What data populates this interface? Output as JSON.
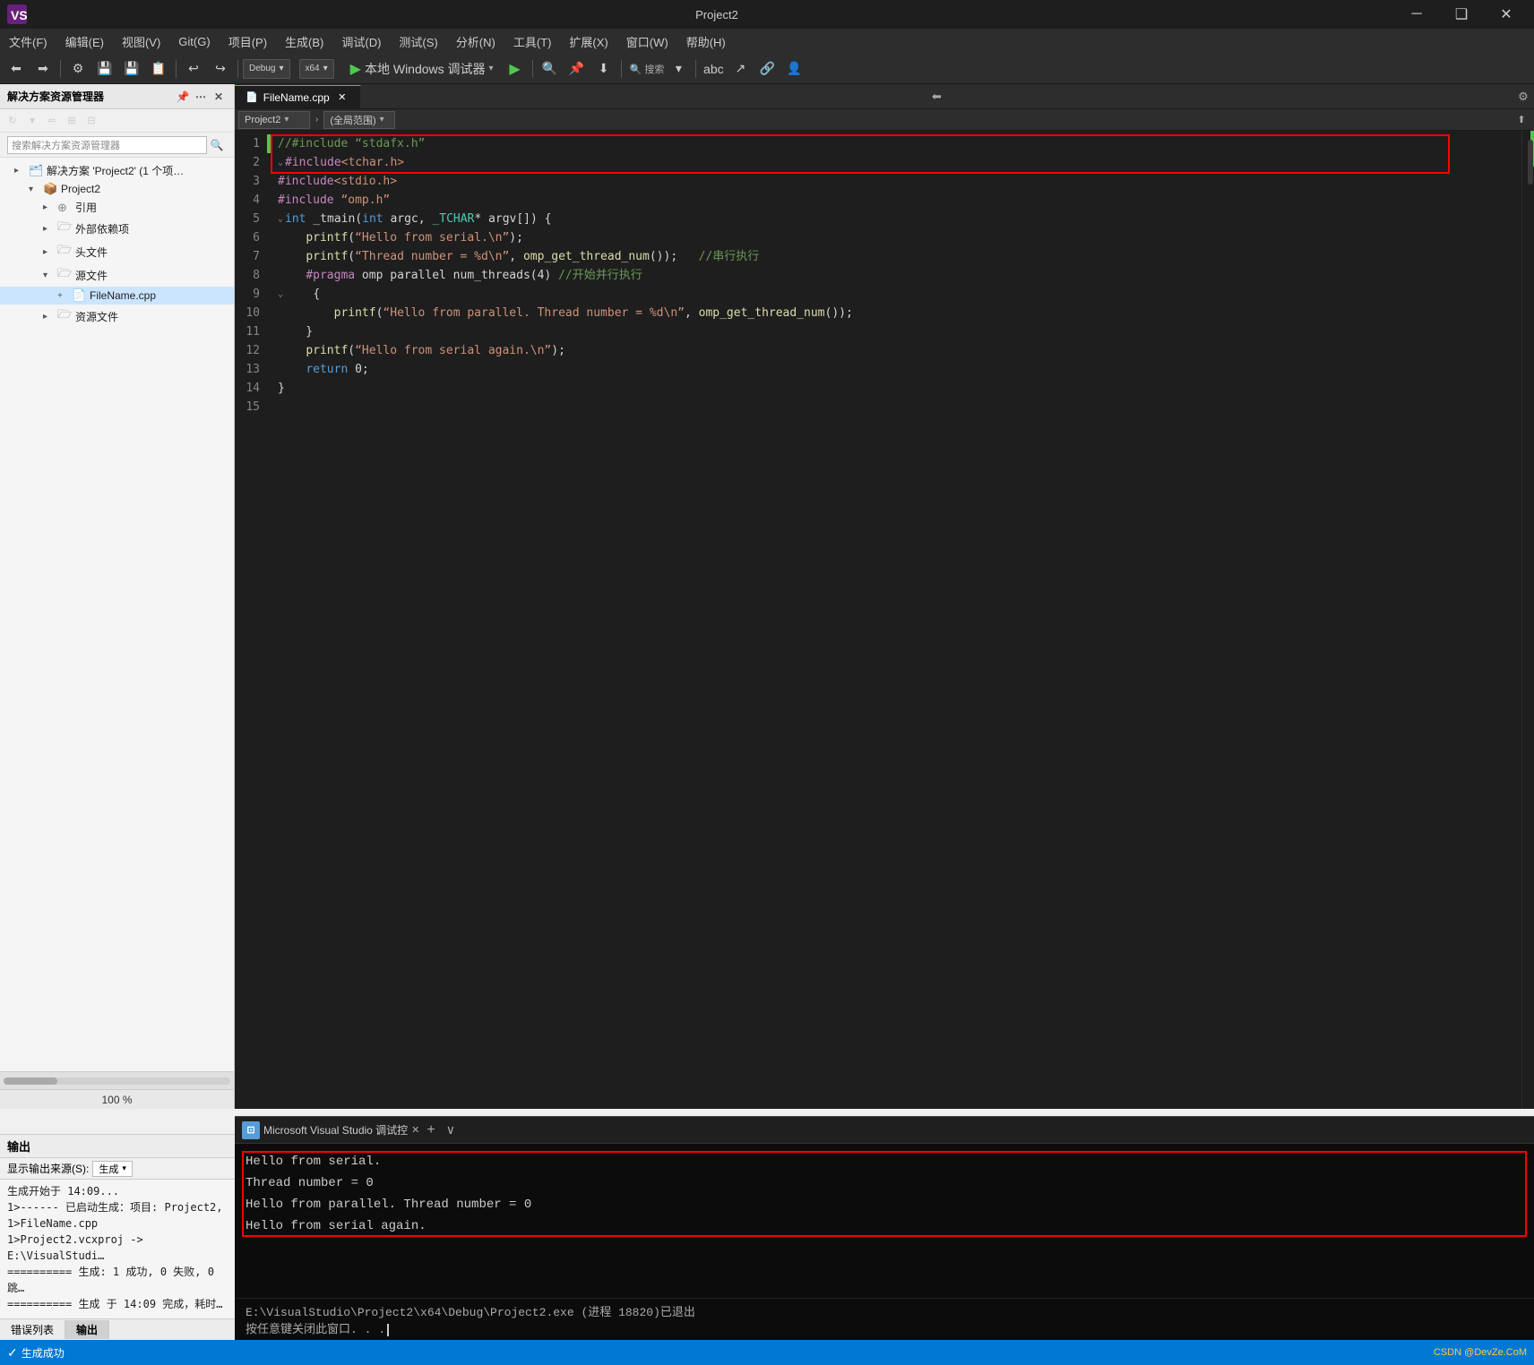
{
  "titleBar": {
    "title": "Project2",
    "minimizeLabel": "─",
    "restoreLabel": "❑",
    "closeLabel": "✕"
  },
  "menuBar": {
    "items": [
      "文件(F)",
      "编辑(E)",
      "视图(V)",
      "Git(G)",
      "项目(P)",
      "生成(B)",
      "调试(D)",
      "测试(S)",
      "分析(N)",
      "工具(T)",
      "扩展(X)",
      "窗口(W)",
      "帮助(H)"
    ]
  },
  "toolbar": {
    "debugConfig": "Debug",
    "platform": "x64",
    "runLabel": "▶ 本地 Windows 调试器",
    "zoomLabel": "100 %"
  },
  "sidebar": {
    "title": "解决方案资源管理器",
    "searchPlaceholder": "搜索解决方案资源管理器",
    "solutionName": "解决方案 'Project2' (1 个项…",
    "projectName": "Project2",
    "items": [
      {
        "label": "引用",
        "type": "folder",
        "indent": 2
      },
      {
        "label": "外部依赖项",
        "type": "folder",
        "indent": 2
      },
      {
        "label": "头文件",
        "type": "folder",
        "indent": 2
      },
      {
        "label": "源文件",
        "type": "folder",
        "indent": 2,
        "expanded": true
      },
      {
        "label": "FileName.cpp",
        "type": "file",
        "indent": 3
      },
      {
        "label": "资源文件",
        "type": "folder",
        "indent": 2
      }
    ]
  },
  "editor": {
    "tabName": "FileName.cpp",
    "breadcrumb1": "Project2",
    "breadcrumb2": "(全局范围)",
    "code": {
      "lines": [
        {
          "num": 1,
          "text": "//#include “stdafx.h”",
          "hasGreen": true,
          "highlight": true
        },
        {
          "num": 2,
          "text": "#include<tchar.h>",
          "hasGreen": false,
          "highlight": true
        },
        {
          "num": 3,
          "text": "#include<stdio.h>",
          "hasGreen": false,
          "highlight": false
        },
        {
          "num": 4,
          "text": "#include “omp.h”",
          "hasGreen": false,
          "highlight": false
        },
        {
          "num": 5,
          "text": "int _tmain(int argc, _TCHAR* argv[]) {",
          "hasGreen": false,
          "highlight": false
        },
        {
          "num": 6,
          "text": "    printf(“Hello from serial.\\n”);",
          "hasGreen": false,
          "highlight": false
        },
        {
          "num": 7,
          "text": "    printf(“Thread number = %d\\n”, omp_get_thread_num());   //串行执行",
          "hasGreen": false,
          "highlight": false
        },
        {
          "num": 8,
          "text": "    #pragma omp parallel num_threads(4) //开始并行执行",
          "hasGreen": false,
          "highlight": false
        },
        {
          "num": 9,
          "text": "    {",
          "hasGreen": false,
          "highlight": false
        },
        {
          "num": 10,
          "text": "        printf(“Hello from parallel. Thread number = %d\\n”, omp_get_thread_num());",
          "hasGreen": false,
          "highlight": false
        },
        {
          "num": 11,
          "text": "    }",
          "hasGreen": false,
          "highlight": false
        },
        {
          "num": 12,
          "text": "    printf(“Hello from serial again.\\n”);",
          "hasGreen": false,
          "highlight": false
        },
        {
          "num": 13,
          "text": "    return 0;",
          "hasGreen": false,
          "highlight": false
        },
        {
          "num": 14,
          "text": "}",
          "hasGreen": false,
          "highlight": false
        },
        {
          "num": 15,
          "text": "",
          "hasGreen": false,
          "highlight": false
        }
      ]
    }
  },
  "terminal": {
    "title": "Microsoft Visual Studio 调试控",
    "closeLabel": "✕",
    "addLabel": "+",
    "expandLabel": "∨",
    "outputLines": [
      "Hello from serial.",
      "Thread number = 0",
      "Hello from parallel. Thread number = 0",
      "Hello from serial again."
    ],
    "footerLine1": "E:\\VisualStudio\\Project2\\x64\\Debug\\Project2.exe (进程 18820)已退出",
    "footerLine2": "按任意键关闭此窗口. . ."
  },
  "outputPanel": {
    "title": "输出",
    "sourceLabel": "显示输出来源(S):",
    "sourceValue": "生成",
    "lines": [
      "生成开始于 14:09...",
      "1>------ 已启动生成：项目: Project2,",
      "1>FileName.cpp",
      "1>Project2.vcxproj -> E:\\VisualStudi…",
      "========== 生成: 1 成功, 0 失败, 0 跳…",
      "========== 生成 于 14:09 完成，耗时…"
    ]
  },
  "bottomTabs": [
    {
      "label": "错误列表"
    },
    {
      "label": "输出"
    }
  ],
  "statusBar": {
    "successLabel": "✓ 生成成功",
    "csdnLabel": "CSDN @DevZe.CoM"
  }
}
